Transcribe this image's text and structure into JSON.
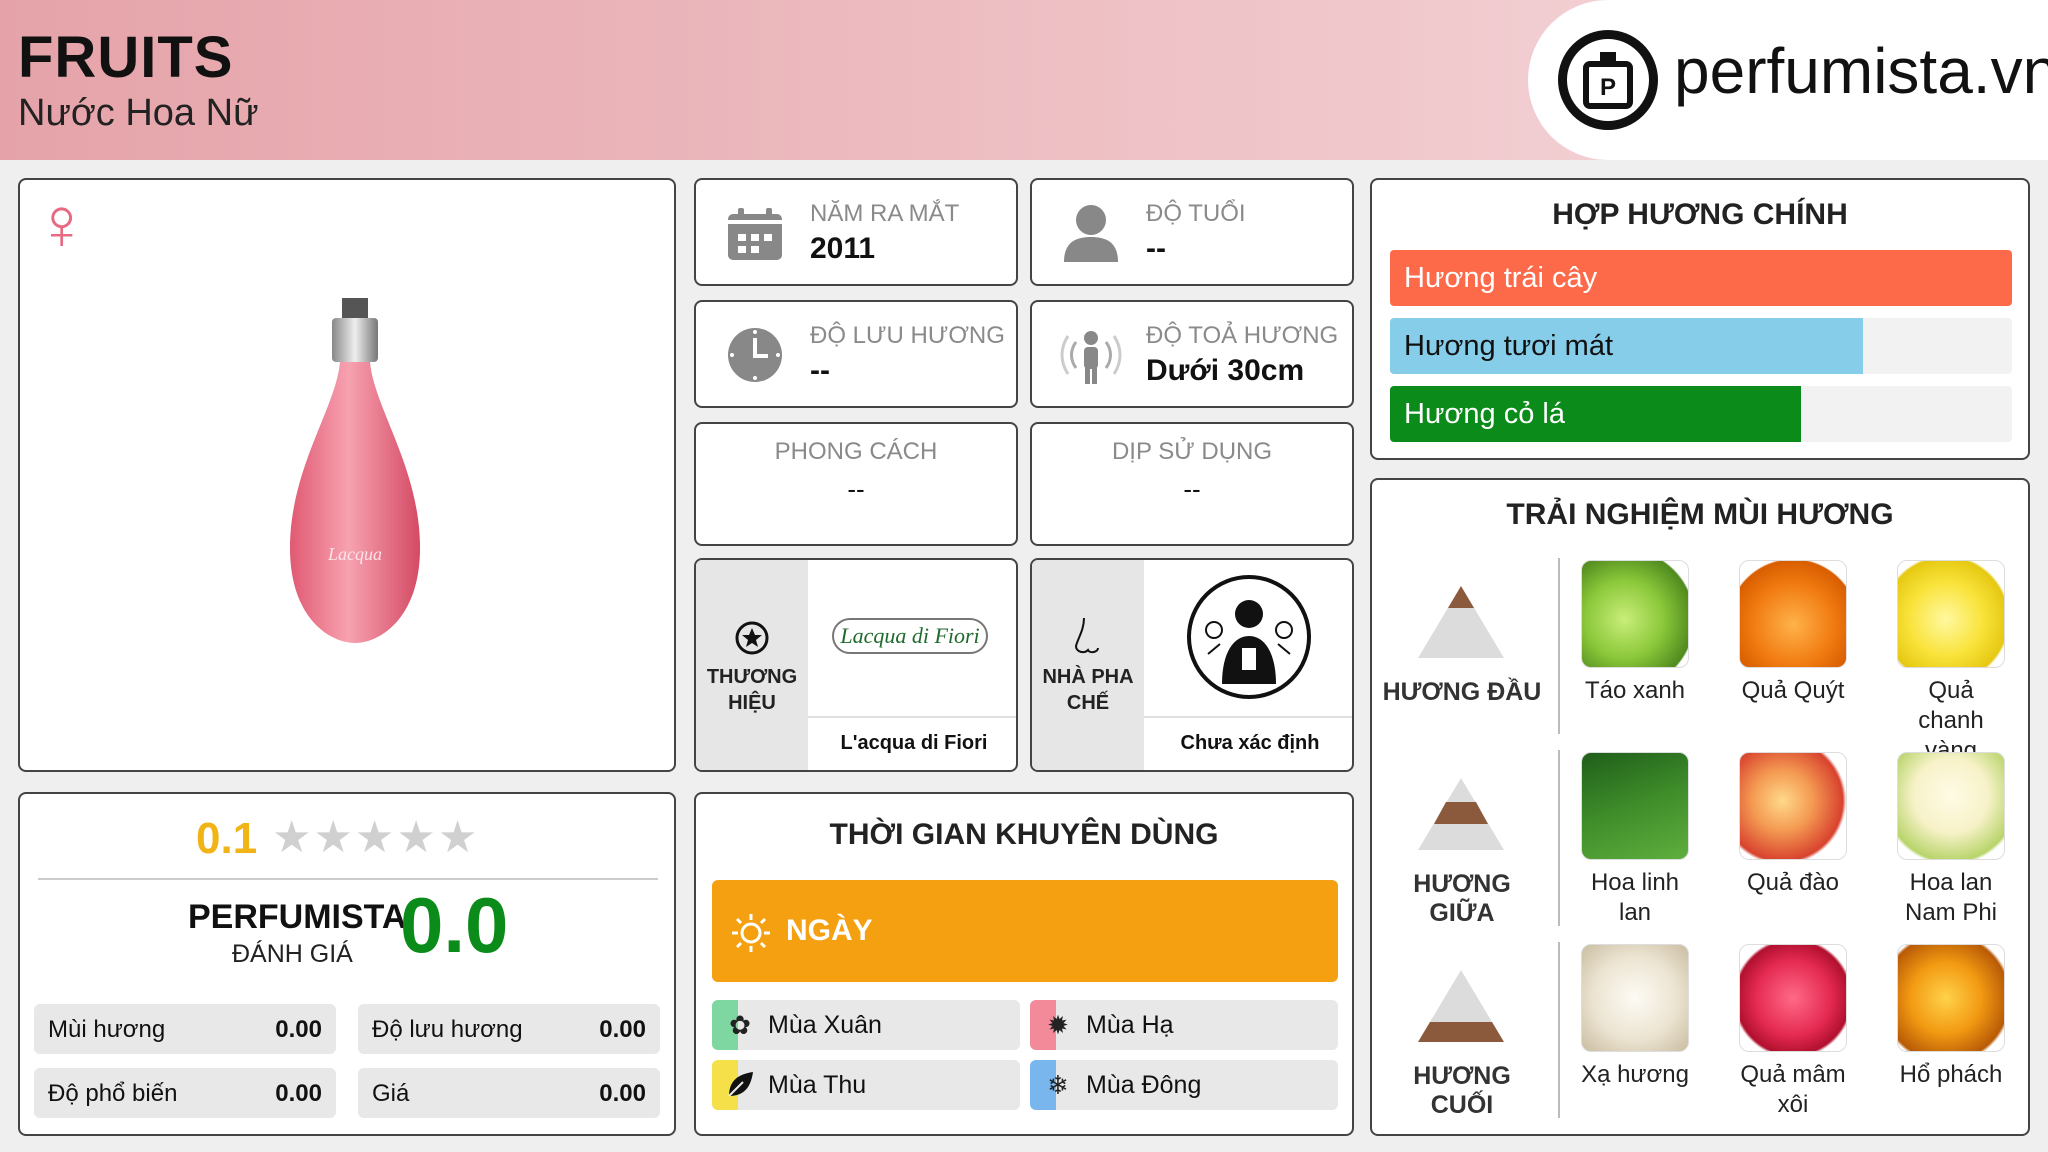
{
  "header": {
    "title": "FRUITS",
    "subtitle": "Nước Hoa Nữ",
    "logo_text": "perfumista.vn",
    "gender_symbol": "♀"
  },
  "stats": {
    "launch_year": {
      "label": "NĂM RA MẮT",
      "value": "2011",
      "icon": "calendar-icon"
    },
    "age": {
      "label": "ĐỘ TUỔI",
      "value": "--",
      "icon": "person-icon"
    },
    "longevity": {
      "label": "ĐỘ LƯU HƯƠNG",
      "value": "--",
      "icon": "clock-icon"
    },
    "sillage": {
      "label": "ĐỘ TOẢ HƯƠNG",
      "value": "Dưới 30cm",
      "icon": "sillage-icon"
    },
    "style": {
      "label": "PHONG CÁCH",
      "value": "--"
    },
    "occasion": {
      "label": "DỊP SỬ DỤNG",
      "value": "--"
    }
  },
  "brand": {
    "label": "THƯƠNG HIỆU",
    "name": "L'acqua di Fiori",
    "logo_script": "Lacqua di Fiori",
    "icon": "star-badge-icon"
  },
  "perfumer": {
    "label": "NHÀ PHA CHẾ",
    "name": "Chưa xác định",
    "icon": "nose-icon"
  },
  "rating": {
    "score": "0.1",
    "stars_filled": 0,
    "stars_total": 5,
    "perfumista_label": "PERFUMISTA",
    "perfumista_sub": "ĐÁNH GIÁ",
    "perfumista_score": "0.0",
    "items": [
      {
        "label": "Mùi hương",
        "value": "0.00"
      },
      {
        "label": "Độ lưu hương",
        "value": "0.00"
      },
      {
        "label": "Độ phổ biến",
        "value": "0.00"
      },
      {
        "label": "Giá",
        "value": "0.00"
      }
    ]
  },
  "usage": {
    "title": "THỜI GIAN KHUYÊN DÙNG",
    "time_label": "NGÀY",
    "time_icon": "sun-icon",
    "seasons": [
      {
        "label": "Mùa Xuân",
        "icon": "flower-icon",
        "color": "#7ed6a0"
      },
      {
        "label": "Mùa Hạ",
        "icon": "summer-sun-icon",
        "color": "#f28a9a"
      },
      {
        "label": "Mùa Thu",
        "icon": "leaf-icon",
        "color": "#f5e04a"
      },
      {
        "label": "Mùa Đông",
        "icon": "snowflake-icon",
        "color": "#7ab6ee"
      }
    ]
  },
  "accords": {
    "title": "HỢP HƯƠNG CHÍNH",
    "items": [
      {
        "label": "Hương trái cây",
        "pct": 100,
        "color": "#fd6a4a"
      },
      {
        "label": "Hương tươi mát",
        "pct": 76,
        "color": "#86cdea"
      },
      {
        "label": "Hương cỏ lá",
        "pct": 66,
        "color": "#0b8c1a"
      }
    ]
  },
  "notes": {
    "title": "TRẢI NGHIỆM MÙI HƯƠNG",
    "levels": [
      {
        "label": "HƯƠNG ĐẦU",
        "items": [
          "Táo xanh",
          "Quả Quýt",
          "Quả chanh vàng"
        ]
      },
      {
        "label": "HƯƠNG GIỮA",
        "items": [
          "Hoa linh lan",
          "Quả đào",
          "Hoa lan Nam Phi"
        ]
      },
      {
        "label": "HƯƠNG CUỐI",
        "items": [
          "Xạ hương",
          "Quả mâm xôi",
          "Hổ phách"
        ]
      }
    ]
  },
  "colors": {
    "accent": "#f5a011",
    "green": "#0b8c1a",
    "gold": "#f1b416",
    "pink": "#e5a3a9"
  }
}
